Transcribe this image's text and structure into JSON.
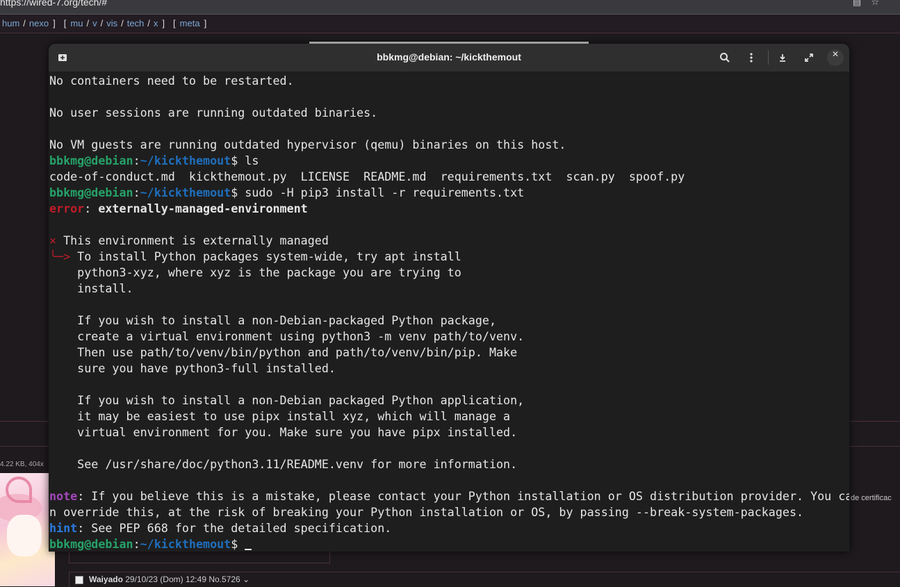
{
  "browser": {
    "url": "https://wired-7.org/tech/#",
    "icons": [
      "reader-icon",
      "star-icon"
    ]
  },
  "board_nav": {
    "group1": [
      "hum",
      "nexo"
    ],
    "group2": [
      "mu",
      "v",
      "vis",
      "tech",
      "x"
    ],
    "group3": [
      "meta"
    ]
  },
  "page": {
    "file_info": "4.22 KB, 404x",
    "side_text": "de certificac",
    "post_name": "Waiyado",
    "post_date": "29/10/23 (Dom) 12:49",
    "post_no": "No.5726",
    "post_arrow": "⌄"
  },
  "terminal": {
    "title": "bbkmg@debian: ~/kickthemout",
    "colors": {
      "user": "#26a269",
      "path": "#1f6fbd",
      "error": "#c01c28",
      "note": "#a347ba",
      "hint": "#2a7bde",
      "bg": "#1e1e1e"
    },
    "user": "bbkmg@debian",
    "path": "~/kickthemout",
    "lines": {
      "l1": "No containers need to be restarted.",
      "l2": "No user sessions are running outdated binaries.",
      "l3": "No VM guests are running outdated hypervisor (qemu) binaries on this host.",
      "cmd1": "$ ls",
      "ls_out": "code-of-conduct.md  kickthemout.py  LICENSE  README.md  requirements.txt  scan.py  spoof.py",
      "cmd2": "$ sudo -H pip3 install -r requirements.txt",
      "error_label": "error",
      "error_msg": "externally-managed-environment",
      "x_mark": "×",
      "managed": " This environment is externally managed",
      "arrow": "╰─>",
      "m1": " To install Python packages system-wide, try apt install",
      "m2": "    python3-xyz, where xyz is the package you are trying to",
      "m3": "    install.",
      "m4": "    If you wish to install a non-Debian-packaged Python package,",
      "m5": "    create a virtual environment using python3 -m venv path/to/venv.",
      "m6": "    Then use path/to/venv/bin/python and path/to/venv/bin/pip. Make",
      "m7": "    sure you have python3-full installed.",
      "m8": "    If you wish to install a non-Debian packaged Python application,",
      "m9": "    it may be easiest to use pipx install xyz, which will manage a",
      "m10": "    virtual environment for you. Make sure you have pipx installed.",
      "m11": "    See /usr/share/doc/python3.11/README.venv for more information.",
      "note_label": "note",
      "note_msg1": ": If you believe this is a mistake, please contact your Python installation or OS distribution provider. You ca",
      "note_msg2": "n override this, at the risk of breaking your Python installation or OS, by passing --break-system-packages.",
      "hint_label": "hint",
      "hint_msg": ": See PEP 668 for the detailed specification.",
      "prompt_end": "$ "
    }
  }
}
